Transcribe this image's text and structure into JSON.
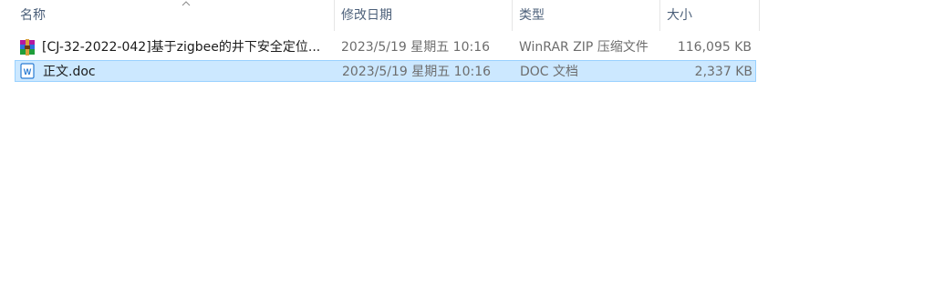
{
  "columns": {
    "name": "名称",
    "date": "修改日期",
    "type": "类型",
    "size": "大小"
  },
  "files": [
    {
      "name": "[CJ-32-2022-042]基于zigbee的井下安全定位...",
      "modified": "2023/5/19 星期五 10:16",
      "type": "WinRAR ZIP 压缩文件",
      "size": "116,095 KB",
      "icon": "winrar-archive-icon"
    },
    {
      "name": "正文.doc",
      "modified": "2023/5/19 星期五 10:16",
      "type": "DOC 文档",
      "size": "2,337 KB",
      "icon": "word-doc-icon",
      "selected": true
    }
  ],
  "colors": {
    "header_text": "#4c607a",
    "selection_bg": "#cce8ff",
    "selection_border": "#99d1ff"
  }
}
